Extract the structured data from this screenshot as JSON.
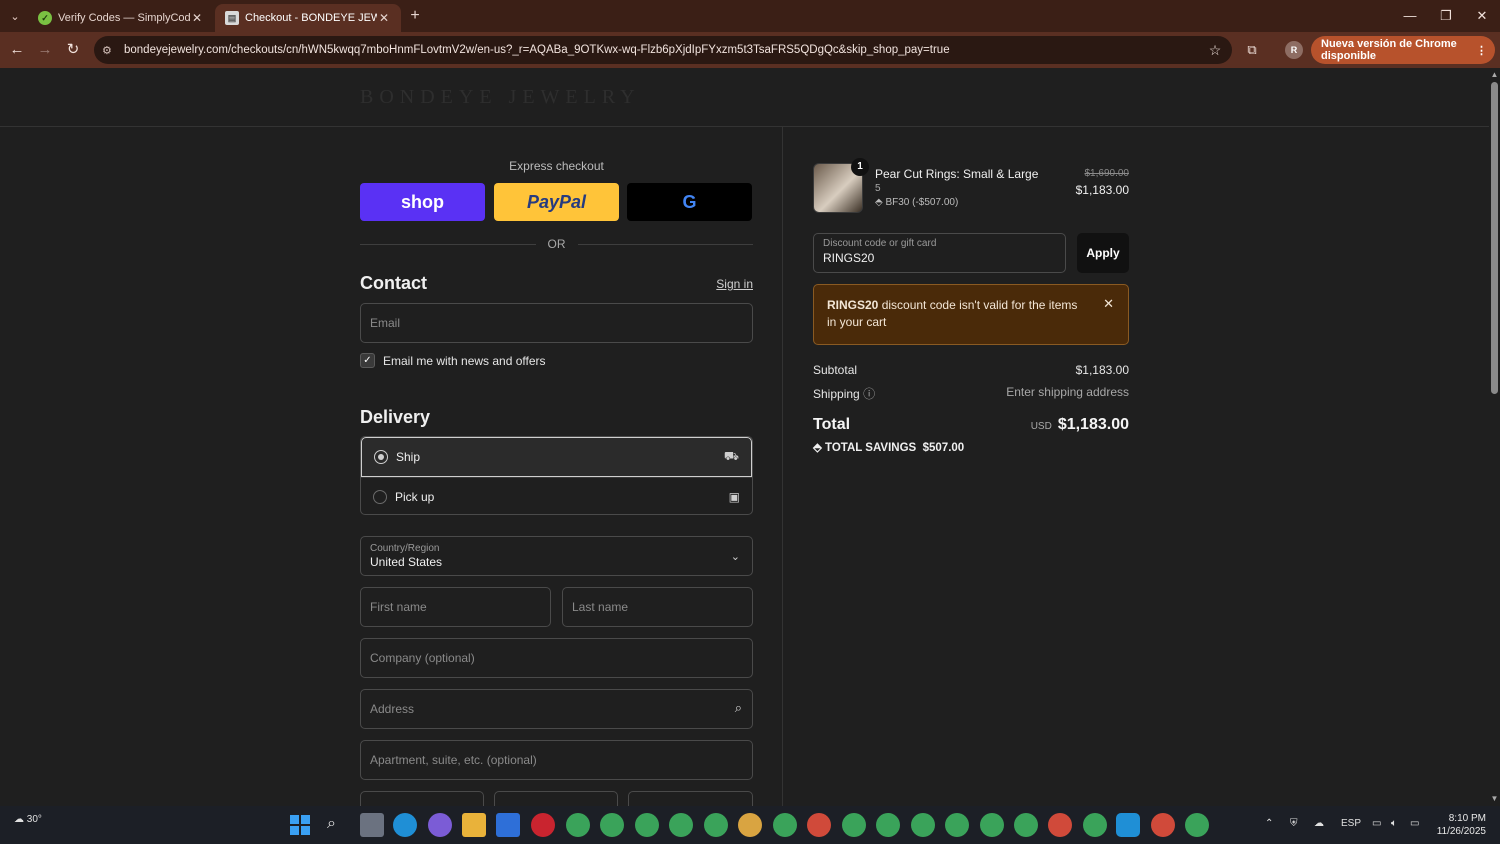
{
  "browser": {
    "tabs": [
      {
        "title": "Verify Codes — SimplyCodes",
        "active": false
      },
      {
        "title": "Checkout - BONDEYE JEWELRY",
        "active": true
      }
    ],
    "url": "bondeyejewelry.com/checkouts/cn/hWN5kwqq7mboHnmFLovtmV2w/en-us?_r=AQABa_9OTKwx-wq-Flzb6pXjdIpFYxzm5t3TsaFRS5QDgQc&skip_shop_pay=true",
    "profile_initial": "R",
    "update_label": "Nueva versión de Chrome disponible"
  },
  "header": {
    "brand": "BONDEYE JEWELRY"
  },
  "express": {
    "title": "Express checkout",
    "shop_label": "shop",
    "paypal_label": "PayPal",
    "gpay_label": "G",
    "or_label": "OR"
  },
  "contact": {
    "title": "Contact",
    "sign_in": "Sign in",
    "email_placeholder": "Email",
    "news_label": "Email me with news and offers",
    "news_checked": true
  },
  "delivery": {
    "title": "Delivery",
    "options": [
      {
        "label": "Ship",
        "selected": true,
        "icon": "truck-icon"
      },
      {
        "label": "Pick up",
        "selected": false,
        "icon": "store-icon"
      }
    ],
    "country_label": "Country/Region",
    "country_value": "United States",
    "first_name": "First name",
    "last_name": "Last name",
    "company": "Company (optional)",
    "address": "Address",
    "apartment": "Apartment, suite, etc. (optional)"
  },
  "summary": {
    "item": {
      "quantity": "1",
      "name": "Pear Cut Rings: Small & Large",
      "variant": "5",
      "discount": "BF30 (-$507.00)",
      "original_price": "$1,690.00",
      "price": "$1,183.00"
    },
    "discount_label": "Discount code or gift card",
    "discount_value": "RINGS20",
    "apply_label": "Apply",
    "error_code": "RINGS20",
    "error_text": " discount code isn't valid for the items in your cart",
    "subtotal_label": "Subtotal",
    "subtotal_value": "$1,183.00",
    "shipping_label": "Shipping",
    "shipping_value": "Enter shipping address",
    "total_label": "Total",
    "total_currency": "USD",
    "total_value": "$1,183.00",
    "savings_label": "TOTAL SAVINGS",
    "savings_value": "$507.00"
  },
  "taskbar": {
    "temperature": "30°",
    "language": "ESP",
    "time": "8:10 PM",
    "date": "11/26/2025"
  },
  "colors": {
    "tab_strip": "#3b1f16",
    "toolbar": "#5a2f22",
    "shop_pay": "#5a31f4",
    "paypal": "#ffc439",
    "update_button": "#b7522c",
    "error_bg": "#4a2a09"
  }
}
